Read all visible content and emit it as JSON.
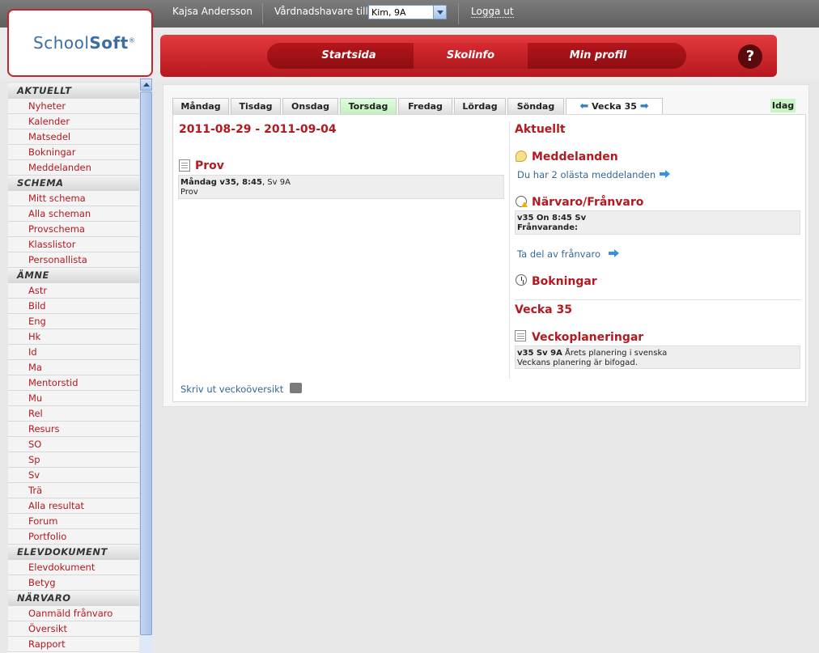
{
  "topbar": {
    "user_name": "Kajsa Andersson",
    "guardian_label": "Vårdnadshavare till",
    "guardian_select_value": "Kim, 9A",
    "logout": "Logga ut"
  },
  "logo": {
    "text_a": "School",
    "text_b": "Soft",
    "mark": "®"
  },
  "nav": {
    "items": [
      "Startsida",
      "Skolinfo",
      "Min profil"
    ],
    "active": "Skolinfo",
    "help": "?"
  },
  "sidebar": {
    "sections": [
      {
        "title": "AKTUELLT",
        "items": [
          "Nyheter",
          "Kalender",
          "Matsedel",
          "Bokningar",
          "Meddelanden"
        ]
      },
      {
        "title": "SCHEMA",
        "items": [
          "Mitt schema",
          "Alla scheman",
          "Provschema",
          "Klasslistor",
          "Personallista"
        ]
      },
      {
        "title": "ÄMNE",
        "items": [
          "Astr",
          "Bild",
          "Eng",
          "Hk",
          "Id",
          "Ma",
          "Mentorstid",
          "Mu",
          "Rel",
          "Resurs",
          "SO",
          "Sp",
          "Sv",
          "Trä",
          "Alla resultat",
          "Forum",
          "Portfolio"
        ]
      },
      {
        "title": "ELEVDOKUMENT",
        "items": [
          "Elevdokument",
          "Betyg"
        ]
      },
      {
        "title": "NÄRVARO",
        "items": [
          "Oanmäld frånvaro",
          "Översikt",
          "Rapport"
        ]
      }
    ]
  },
  "tabs": {
    "days": [
      "Måndag",
      "Tisdag",
      "Onsdag",
      "Torsdag",
      "Fredag",
      "Lördag",
      "Söndag"
    ],
    "highlighted": "Torsdag",
    "week_label": "Vecka 35",
    "today": "Idag"
  },
  "left": {
    "date_range": "2011-08-29 - 2011-09-04",
    "prov_title": "Prov",
    "prov_line_bold": "Måndag v35, 8:45",
    "prov_line_rest": ", Sv 9A",
    "prov_desc": "Prov",
    "print_link": "Skriv ut veckoöversikt"
  },
  "right": {
    "aktuellt": "Aktuellt",
    "meddelanden_title": "Meddelanden",
    "meddelanden_text": "Du har 2 olästa meddelanden",
    "narvaro_title": "Närvaro/Frånvaro",
    "narvaro_line1": "v35 On 8:45 Sv",
    "narvaro_line2": "Frånvarande:",
    "narvaro_link": "Ta del av frånvaro",
    "bokningar_title": "Bokningar",
    "vecka_title": "Vecka 35",
    "veckoplan_title": "Veckoplaneringar",
    "veckoplan_bold": "v35 Sv 9A",
    "veckoplan_rest": " Årets planering i svenska",
    "veckoplan_line2": "Veckans planering är bifogad."
  }
}
